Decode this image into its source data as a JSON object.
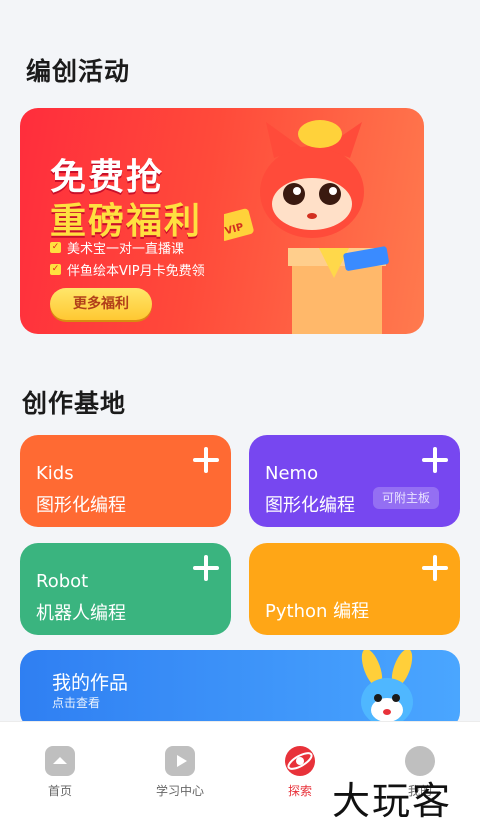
{
  "sections": {
    "activities_title": "编创活动",
    "workshop_title": "创作基地"
  },
  "banner": {
    "headline1": "免费抢",
    "headline2": "重磅福利",
    "perks": [
      "美术宝一对一直播课",
      "伴鱼绘本VIP月卡免费领"
    ],
    "button": "更多福利",
    "badge": "VIP"
  },
  "cards": {
    "kids": {
      "line1": "Kids",
      "line2": "图形化编程"
    },
    "nemo": {
      "line1": "Nemo",
      "line2": "图形化编程",
      "tag": "可附主板"
    },
    "robot": {
      "line1": "Robot",
      "line2": "机器人编程"
    },
    "python": {
      "label": "Python 编程"
    }
  },
  "works": {
    "title": "我的作品",
    "subtitle": "点击查看"
  },
  "tabbar": {
    "tabs": [
      {
        "label": "首页",
        "icon": "home-icon"
      },
      {
        "label": "学习中心",
        "icon": "play-icon"
      },
      {
        "label": "探索",
        "icon": "explore-icon",
        "active": true
      },
      {
        "label": "我的",
        "icon": "profile-icon"
      }
    ]
  },
  "watermark": "大玩客",
  "colors": {
    "accent_red": "#e8323a",
    "kids": "#ff6a33",
    "nemo": "#7747f0",
    "robot": "#3ab47f",
    "python": "#ffa616",
    "works": "#3b8ff6"
  }
}
